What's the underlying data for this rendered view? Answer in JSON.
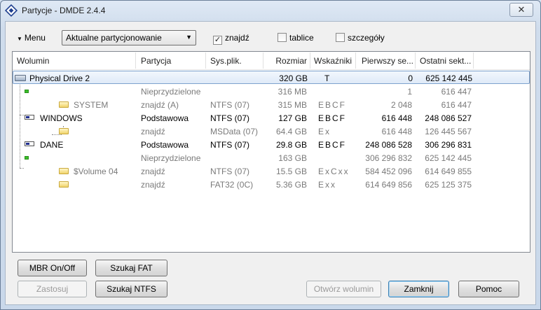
{
  "window": {
    "title": "Partycje - DMDE 2.4.4",
    "close_glyph": "✕"
  },
  "toolbar": {
    "menu_label": "Menu",
    "view_select_value": "Aktualne partycjonowanie",
    "checks": [
      {
        "label": "znajdź",
        "checked": true
      },
      {
        "label": "tablice",
        "checked": false
      },
      {
        "label": "szczegóły",
        "checked": false
      }
    ]
  },
  "table": {
    "columns": [
      "Wolumin",
      "Partycja",
      "Sys.plik.",
      "Rozmiar",
      "Wskaźniki",
      "Pierwszy se...",
      "Ostatni sekt..."
    ],
    "rows": [
      {
        "icon": "drive-icon",
        "name": "Physical Drive 2",
        "partition": "",
        "fs": "",
        "size": "320 GB",
        "flags": "T",
        "first": "0",
        "last": "625 142 445",
        "gray": false,
        "selected": true
      },
      {
        "icon": "free-space-icon",
        "name": "",
        "partition": "Nieprzydzielone",
        "fs": "",
        "size": "316 MB",
        "flags": "",
        "first": "1",
        "last": "616 447",
        "gray": true,
        "selected": false
      },
      {
        "icon": "folder-icon",
        "name": "SYSTEM",
        "partition": "znajdź (A)",
        "fs": "NTFS (07)",
        "size": "315 MB",
        "flags": "EBCF",
        "first": "2 048",
        "last": "616 447",
        "gray": true,
        "selected": false
      },
      {
        "icon": "partition-icon",
        "name": "WINDOWS",
        "partition": "Podstawowa",
        "fs": "NTFS (07)",
        "size": "127 GB",
        "flags": "EBCF",
        "first": "616 448",
        "last": "248 086 527",
        "gray": false,
        "selected": false
      },
      {
        "icon": "folder-icon",
        "name": "",
        "partition": "znajdź",
        "fs": "MSData (07)",
        "size": "64.4 GB",
        "flags": "Ex",
        "first": "616 448",
        "last": "126 445 567",
        "gray": true,
        "selected": false
      },
      {
        "icon": "partition-icon",
        "name": "DANE",
        "partition": "Podstawowa",
        "fs": "NTFS (07)",
        "size": "29.8 GB",
        "flags": "EBCF",
        "first": "248 086 528",
        "last": "306 296 831",
        "gray": false,
        "selected": false
      },
      {
        "icon": "free-space-icon",
        "name": "",
        "partition": "Nieprzydzielone",
        "fs": "",
        "size": "163 GB",
        "flags": "",
        "first": "306 296 832",
        "last": "625 142 445",
        "gray": true,
        "selected": false
      },
      {
        "icon": "folder-icon",
        "name": "$Volume 04",
        "partition": "znajdź",
        "fs": "NTFS (07)",
        "size": "15.5 GB",
        "flags": "ExCxx",
        "first": "584 452 096",
        "last": "614 649 855",
        "gray": true,
        "selected": false
      },
      {
        "icon": "folder-icon",
        "name": "",
        "partition": "znajdź",
        "fs": "FAT32 (0C)",
        "size": "5.36 GB",
        "flags": "Exx",
        "first": "614 649 856",
        "last": "625 125 375",
        "gray": true,
        "selected": false
      }
    ]
  },
  "buttons": {
    "mbr": "MBR On/Off",
    "find_fat": "Szukaj FAT",
    "apply": "Zastosuj",
    "find_ntfs": "Szukaj NTFS",
    "open_volume": "Otwórz wolumin",
    "close": "Zamknij",
    "help": "Pomoc"
  }
}
